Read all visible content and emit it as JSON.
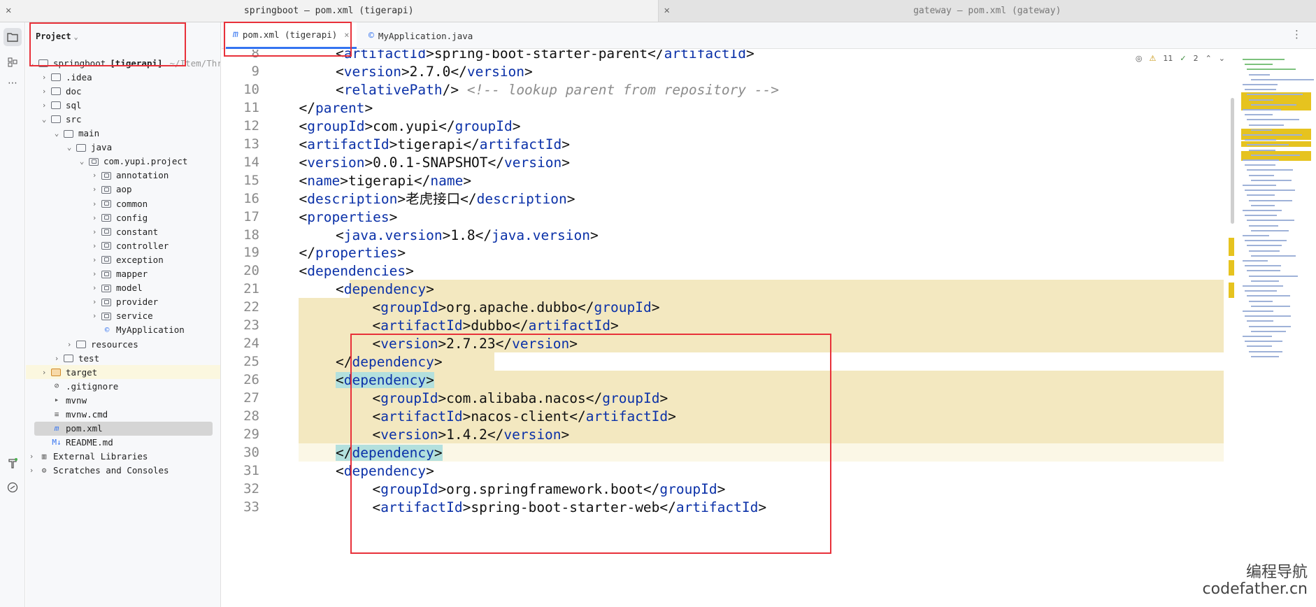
{
  "window_tabs": [
    {
      "title": "springboot – pom.xml (tigerapi)",
      "close": "✕"
    },
    {
      "title": "gateway – pom.xml (gateway)",
      "close": "✕"
    }
  ],
  "toolstrip": {
    "icons": [
      "folder-icon",
      "structure-icon",
      "more-icon",
      "build-icon",
      "problems-icon"
    ]
  },
  "project": {
    "header": "Project",
    "tree": [
      {
        "label": "springboot",
        "bold_suffix": "[tigerapi]",
        "dim": "~/Item/Thre",
        "depth": 0,
        "arrow": "open",
        "icon": "module"
      },
      {
        "label": ".idea",
        "depth": 1,
        "arrow": "closed",
        "icon": "folder"
      },
      {
        "label": "doc",
        "depth": 1,
        "arrow": "closed",
        "icon": "folder"
      },
      {
        "label": "sql",
        "depth": 1,
        "arrow": "closed",
        "icon": "folder"
      },
      {
        "label": "src",
        "depth": 1,
        "arrow": "open",
        "icon": "folder"
      },
      {
        "label": "main",
        "depth": 2,
        "arrow": "open",
        "icon": "folder"
      },
      {
        "label": "java",
        "depth": 3,
        "arrow": "open",
        "icon": "folder"
      },
      {
        "label": "com.yupi.project",
        "depth": 4,
        "arrow": "open",
        "icon": "package"
      },
      {
        "label": "annotation",
        "depth": 5,
        "arrow": "closed",
        "icon": "package"
      },
      {
        "label": "aop",
        "depth": 5,
        "arrow": "closed",
        "icon": "package"
      },
      {
        "label": "common",
        "depth": 5,
        "arrow": "closed",
        "icon": "package"
      },
      {
        "label": "config",
        "depth": 5,
        "arrow": "closed",
        "icon": "package"
      },
      {
        "label": "constant",
        "depth": 5,
        "arrow": "closed",
        "icon": "package"
      },
      {
        "label": "controller",
        "depth": 5,
        "arrow": "closed",
        "icon": "package"
      },
      {
        "label": "exception",
        "depth": 5,
        "arrow": "closed",
        "icon": "package"
      },
      {
        "label": "mapper",
        "depth": 5,
        "arrow": "closed",
        "icon": "package"
      },
      {
        "label": "model",
        "depth": 5,
        "arrow": "closed",
        "icon": "package"
      },
      {
        "label": "provider",
        "depth": 5,
        "arrow": "closed",
        "icon": "package"
      },
      {
        "label": "service",
        "depth": 5,
        "arrow": "closed",
        "icon": "package"
      },
      {
        "label": "MyApplication",
        "depth": 5,
        "arrow": "none",
        "icon": "class"
      },
      {
        "label": "resources",
        "depth": 3,
        "arrow": "closed",
        "icon": "folder"
      },
      {
        "label": "test",
        "depth": 2,
        "arrow": "closed",
        "icon": "folder"
      },
      {
        "label": "target",
        "depth": 1,
        "arrow": "closed",
        "icon": "folder-orange",
        "highlight": true
      },
      {
        "label": ".gitignore",
        "depth": 1,
        "arrow": "none",
        "icon": "ignore"
      },
      {
        "label": "mvnw",
        "depth": 1,
        "arrow": "none",
        "icon": "shell"
      },
      {
        "label": "mvnw.cmd",
        "depth": 1,
        "arrow": "none",
        "icon": "text"
      },
      {
        "label": "pom.xml",
        "depth": 1,
        "arrow": "none",
        "icon": "maven",
        "selected": true
      },
      {
        "label": "README.md",
        "depth": 1,
        "arrow": "none",
        "icon": "markdown"
      },
      {
        "label": "External Libraries",
        "depth": 0,
        "arrow": "closed",
        "icon": "library"
      },
      {
        "label": "Scratches and Consoles",
        "depth": 0,
        "arrow": "closed",
        "icon": "scratch"
      }
    ]
  },
  "editor_tabs": [
    {
      "label": "pom.xml (tigerapi)",
      "icon": "m",
      "active": true,
      "close": "×"
    },
    {
      "label": "MyApplication.java",
      "icon": "©",
      "active": false
    }
  ],
  "inspections": {
    "warnings": "11",
    "ok": "2"
  },
  "code": [
    {
      "n": "8",
      "indent": 2,
      "parts": [
        [
          "t",
          "<"
        ],
        [
          "tag",
          "artifactId"
        ],
        [
          "t",
          ">spring-boot-starter-parent</"
        ],
        [
          "tag",
          "artifactId"
        ],
        [
          "t",
          ">"
        ]
      ]
    },
    {
      "n": "9",
      "indent": 2,
      "parts": [
        [
          "t",
          "<"
        ],
        [
          "tag",
          "version"
        ],
        [
          "t",
          ">2.7.0</"
        ],
        [
          "tag",
          "version"
        ],
        [
          "t",
          ">"
        ]
      ]
    },
    {
      "n": "10",
      "indent": 2,
      "parts": [
        [
          "t",
          "<"
        ],
        [
          "tag",
          "relativePath"
        ],
        [
          "t",
          "/> "
        ],
        [
          "cmt",
          "<!-- lookup parent from repository -->"
        ]
      ]
    },
    {
      "n": "11",
      "indent": 1,
      "parts": [
        [
          "t",
          "</"
        ],
        [
          "tag",
          "parent"
        ],
        [
          "t",
          ">"
        ]
      ]
    },
    {
      "n": "12",
      "indent": 1,
      "parts": [
        [
          "t",
          "<"
        ],
        [
          "tag",
          "groupId"
        ],
        [
          "t",
          ">com.yupi</"
        ],
        [
          "tag",
          "groupId"
        ],
        [
          "t",
          ">"
        ]
      ]
    },
    {
      "n": "13",
      "indent": 1,
      "parts": [
        [
          "t",
          "<"
        ],
        [
          "tag",
          "artifactId"
        ],
        [
          "t",
          ">tigerapi</"
        ],
        [
          "tag",
          "artifactId"
        ],
        [
          "t",
          ">"
        ]
      ]
    },
    {
      "n": "14",
      "indent": 1,
      "parts": [
        [
          "t",
          "<"
        ],
        [
          "tag",
          "version"
        ],
        [
          "t",
          ">0.0.1-SNAPSHOT</"
        ],
        [
          "tag",
          "version"
        ],
        [
          "t",
          ">"
        ]
      ]
    },
    {
      "n": "15",
      "indent": 1,
      "parts": [
        [
          "t",
          "<"
        ],
        [
          "tag",
          "name"
        ],
        [
          "t",
          ">tigerapi</"
        ],
        [
          "tag",
          "name"
        ],
        [
          "t",
          ">"
        ]
      ]
    },
    {
      "n": "16",
      "indent": 1,
      "parts": [
        [
          "t",
          "<"
        ],
        [
          "tag",
          "description"
        ],
        [
          "t",
          ">老虎接口</"
        ],
        [
          "tag",
          "description"
        ],
        [
          "t",
          ">"
        ]
      ]
    },
    {
      "n": "17",
      "indent": 1,
      "parts": [
        [
          "t",
          "<"
        ],
        [
          "tag",
          "properties"
        ],
        [
          "t",
          ">"
        ]
      ]
    },
    {
      "n": "18",
      "indent": 2,
      "parts": [
        [
          "t",
          "<"
        ],
        [
          "tag",
          "java.version"
        ],
        [
          "t",
          ">1.8</"
        ],
        [
          "tag",
          "java.version"
        ],
        [
          "t",
          ">"
        ]
      ]
    },
    {
      "n": "19",
      "indent": 1,
      "parts": [
        [
          "t",
          "</"
        ],
        [
          "tag",
          "properties"
        ],
        [
          "t",
          ">"
        ]
      ]
    },
    {
      "n": "20",
      "indent": 1,
      "parts": [
        [
          "t",
          "<"
        ],
        [
          "tag",
          "dependencies"
        ],
        [
          "t",
          ">"
        ]
      ]
    },
    {
      "n": "21",
      "indent": 2,
      "parts": [
        [
          "t",
          "<"
        ],
        [
          "tag",
          "dependency"
        ],
        [
          "t",
          ">"
        ]
      ],
      "bg": "changed"
    },
    {
      "n": "22",
      "indent": 3,
      "parts": [
        [
          "t",
          "<"
        ],
        [
          "tag",
          "groupId"
        ],
        [
          "t",
          ">org.apache.dubbo</"
        ],
        [
          "tag",
          "groupId"
        ],
        [
          "t",
          ">"
        ]
      ],
      "bg": "changed"
    },
    {
      "n": "23",
      "indent": 3,
      "parts": [
        [
          "t",
          "<"
        ],
        [
          "tag",
          "artifactId"
        ],
        [
          "t",
          ">dubbo</"
        ],
        [
          "tag",
          "artifactId"
        ],
        [
          "t",
          ">"
        ]
      ],
      "bg": "changed"
    },
    {
      "n": "24",
      "indent": 3,
      "parts": [
        [
          "t",
          "<"
        ],
        [
          "tag",
          "version"
        ],
        [
          "t",
          ">2.7.23</"
        ],
        [
          "tag",
          "version"
        ],
        [
          "t",
          ">"
        ]
      ],
      "bg": "changed"
    },
    {
      "n": "25",
      "indent": 2,
      "parts": [
        [
          "t",
          "</"
        ],
        [
          "tag",
          "dependency"
        ],
        [
          "t",
          ">"
        ]
      ],
      "bg": "changed-short"
    },
    {
      "n": "26",
      "indent": 2,
      "parts": [
        [
          "m",
          "<"
        ],
        [
          "mtag",
          "dependency"
        ],
        [
          "m",
          ">"
        ]
      ],
      "bg": "changed"
    },
    {
      "n": "27",
      "indent": 3,
      "parts": [
        [
          "t",
          "<"
        ],
        [
          "tag",
          "groupId"
        ],
        [
          "t",
          ">com.alibaba.nacos</"
        ],
        [
          "tag",
          "groupId"
        ],
        [
          "t",
          ">"
        ]
      ],
      "bg": "changed"
    },
    {
      "n": "28",
      "indent": 3,
      "parts": [
        [
          "t",
          "<"
        ],
        [
          "tag",
          "artifactId"
        ],
        [
          "t",
          ">nacos-client</"
        ],
        [
          "tag",
          "artifactId"
        ],
        [
          "t",
          ">"
        ]
      ],
      "bg": "changed"
    },
    {
      "n": "29",
      "indent": 3,
      "parts": [
        [
          "t",
          "<"
        ],
        [
          "tag",
          "version"
        ],
        [
          "t",
          ">1.4.2</"
        ],
        [
          "tag",
          "version"
        ],
        [
          "t",
          ">"
        ]
      ],
      "bg": "changed"
    },
    {
      "n": "30",
      "indent": 2,
      "parts": [
        [
          "m",
          "</"
        ],
        [
          "mtag",
          "dependency"
        ],
        [
          "m",
          ">"
        ]
      ],
      "bg": "current"
    },
    {
      "n": "31",
      "indent": 2,
      "parts": [
        [
          "t",
          "<"
        ],
        [
          "tag",
          "dependency"
        ],
        [
          "t",
          ">"
        ]
      ]
    },
    {
      "n": "32",
      "indent": 3,
      "parts": [
        [
          "t",
          "<"
        ],
        [
          "tag",
          "groupId"
        ],
        [
          "t",
          ">org.springframework.boot</"
        ],
        [
          "tag",
          "groupId"
        ],
        [
          "t",
          ">"
        ]
      ]
    },
    {
      "n": "33",
      "indent": 3,
      "parts": [
        [
          "t",
          "<"
        ],
        [
          "tag",
          "artifactId"
        ],
        [
          "t",
          ">spring-boot-starter-web</"
        ],
        [
          "tag",
          "artifactId"
        ],
        [
          "t",
          ">"
        ]
      ]
    }
  ],
  "watermark": {
    "line1": "编程导航",
    "line2": "codefather.cn"
  },
  "colors": {
    "tag": "#0b31a8",
    "changed_bg": "#f3e8c0",
    "annotation_red": "#e8313a",
    "accent": "#3574f0"
  }
}
